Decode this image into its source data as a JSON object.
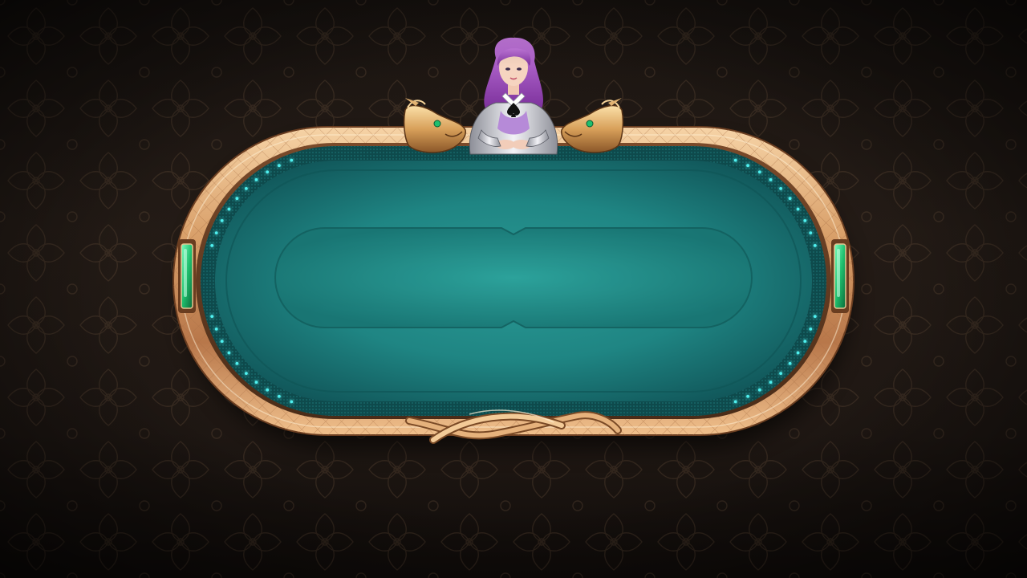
{
  "scene": {
    "type": "poker-table",
    "felt_color": "#1f8583",
    "felt_dark": "#0e4a4c",
    "rail_color": "#d9a06a",
    "rail_highlight": "#f6d3a6",
    "gem_color": "#1fbf6e",
    "led_color": "#4ff1f0",
    "background_color": "#1d1612"
  },
  "dealer": {
    "icon": "spade-icon",
    "hair_color": "#a24fc0",
    "decor": [
      "dragon-head-left-icon",
      "dragon-head-right-icon"
    ]
  }
}
